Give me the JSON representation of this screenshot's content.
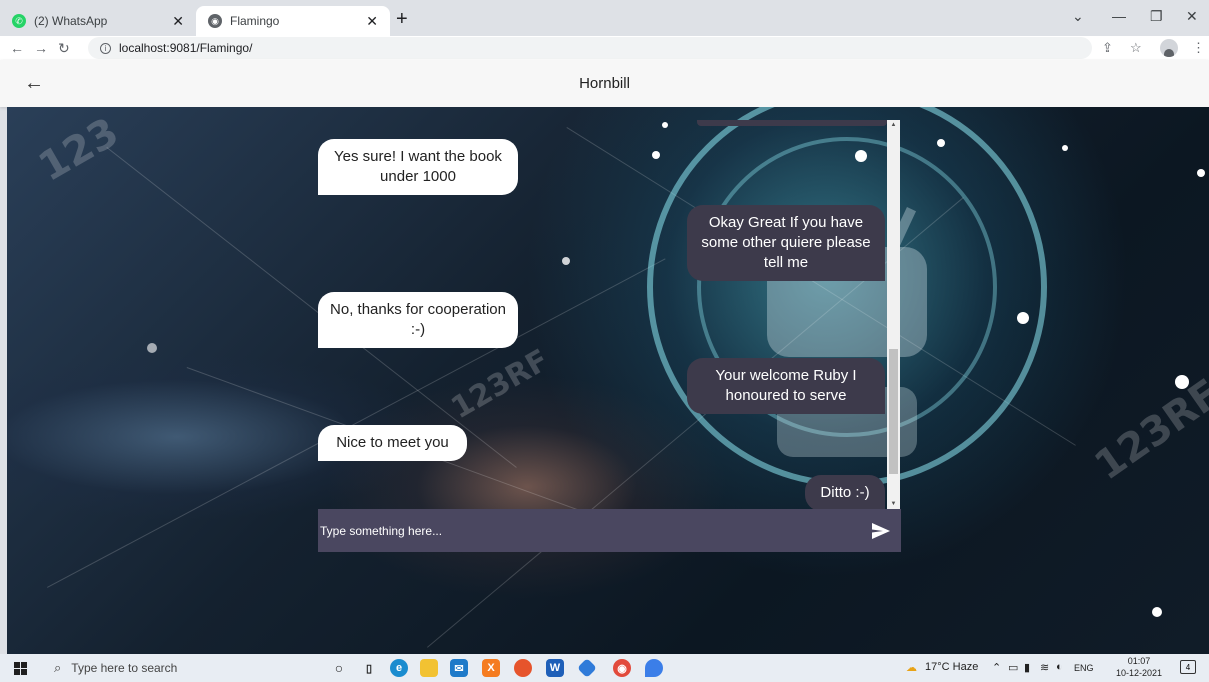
{
  "browser": {
    "tabs": [
      {
        "label": "(2) WhatsApp",
        "icon": "whatsapp-icon",
        "active": false
      },
      {
        "label": "Flamingo",
        "icon": "globe-icon",
        "active": true
      }
    ],
    "url": "localhost:9081/Flamingo/"
  },
  "app": {
    "title": "Hornbill"
  },
  "chat": {
    "messages": [
      {
        "sender": "user",
        "text": "Yes sure! I want the book under 1000"
      },
      {
        "sender": "bot",
        "text": "Okay Great If you have some other quiere please tell me"
      },
      {
        "sender": "user",
        "text": "No, thanks for cooperation :-)"
      },
      {
        "sender": "bot",
        "text": "Your welcome Ruby I honoured to serve"
      },
      {
        "sender": "user",
        "text": "Nice to meet you"
      },
      {
        "sender": "bot",
        "text": "Ditto :-)"
      }
    ],
    "input_placeholder": "Type something here...",
    "colors": {
      "bot_bubble": "#3d3a4b",
      "user_bubble": "#ffffff",
      "input_bar": "#4a4760"
    }
  },
  "taskbar": {
    "search_placeholder": "Type here to search",
    "weather": "17°C  Haze",
    "language": "ENG",
    "time": "01:07",
    "date": "10-12-2021",
    "notification_count": "4"
  }
}
